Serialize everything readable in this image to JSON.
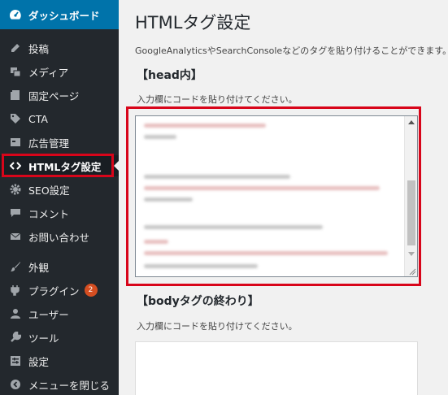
{
  "sidebar": {
    "items": [
      {
        "label": "ダッシュボード",
        "icon": "dashboard-icon"
      },
      {
        "label": "投稿",
        "icon": "pin-icon"
      },
      {
        "label": "メディア",
        "icon": "media-icon"
      },
      {
        "label": "固定ページ",
        "icon": "page-icon"
      },
      {
        "label": "CTA",
        "icon": "tag-icon"
      },
      {
        "label": "広告管理",
        "icon": "ad-icon"
      },
      {
        "label": "HTMLタグ設定",
        "icon": "code-icon"
      },
      {
        "label": "SEO設定",
        "icon": "gear-icon"
      },
      {
        "label": "コメント",
        "icon": "comment-icon"
      },
      {
        "label": "お問い合わせ",
        "icon": "mail-icon"
      },
      {
        "label": "外観",
        "icon": "brush-icon"
      },
      {
        "label": "プラグイン",
        "icon": "plugin-icon",
        "badge": "2"
      },
      {
        "label": "ユーザー",
        "icon": "user-icon"
      },
      {
        "label": "ツール",
        "icon": "wrench-icon"
      },
      {
        "label": "設定",
        "icon": "settings-icon"
      },
      {
        "label": "メニューを閉じる",
        "icon": "collapse-icon"
      }
    ]
  },
  "main": {
    "title": "HTMLタグ設定",
    "description": "GoogleAnalyticsやSearchConsoleなどのタグを貼り付けることができます。",
    "head_section": {
      "title": "【head内】",
      "hint": "入力欄にコードを貼り付けてください。"
    },
    "body_section": {
      "title": "【bodyタグの終わり】",
      "hint": "入力欄にコードを貼り付けてください。"
    }
  },
  "colors": {
    "sidebar_bg": "#23282d",
    "dashboard_bg": "#0073aa",
    "highlight_red": "#d8051a",
    "badge_orange": "#d54e21"
  }
}
